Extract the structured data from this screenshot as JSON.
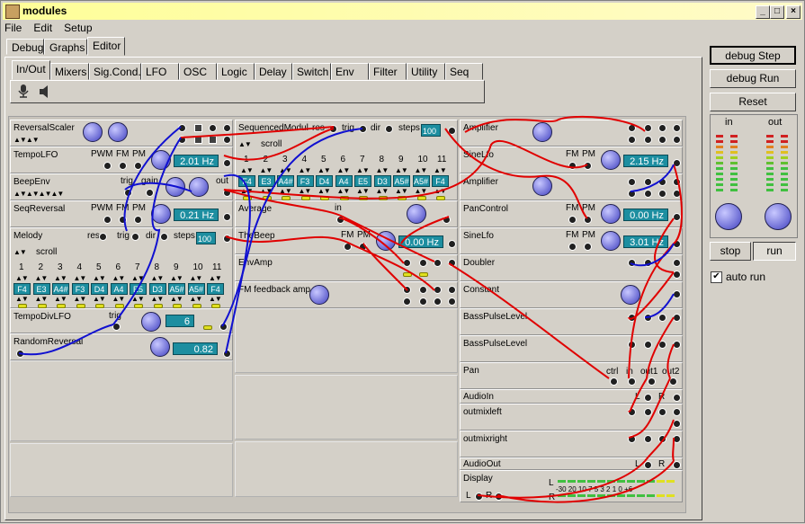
{
  "window": {
    "title": "modules",
    "buttons": [
      "_",
      "□",
      "×"
    ]
  },
  "menu": [
    "File",
    "Edit",
    "Setup"
  ],
  "main_tabs": [
    "Debug",
    "Graphs",
    "Editor"
  ],
  "sub_tabs": [
    "In/Out",
    "Mixers",
    "Sig.Cond.",
    "LFO",
    "OSC",
    "Logic",
    "Delay",
    "Switch",
    "Env",
    "Filter",
    "Utility",
    "Seq"
  ],
  "right_panel": {
    "debug_step": "debug Step",
    "debug_run": "debug Run",
    "reset": "Reset",
    "meter_in": "in",
    "meter_out": "out",
    "stop": "stop",
    "run": "run",
    "auto_run": "auto run"
  },
  "col1": {
    "reversal_scaler": "ReversalScaler",
    "tempo_lfo": "TempoLFO",
    "tempo_lfo_pwm": "PWM",
    "tempo_lfo_fm": "FM",
    "tempo_lfo_pm": "PM",
    "tempo_lfo_value": "2.01 Hz",
    "beep_env": "BeepEnv",
    "beep_env_trig": "trig",
    "beep_env_gain": "gain",
    "beep_env_out": "out",
    "seq_reversal": "SeqReversal",
    "seq_reversal_pwm": "PWM",
    "seq_reversal_fm": "FM",
    "seq_reversal_pm": "PM",
    "seq_reversal_value": "0.21 Hz",
    "melody": "Melody",
    "melody_res": "res",
    "melody_trig": "trig",
    "melody_dir": "dir",
    "melody_steps": "steps",
    "melody_steps_value": "100",
    "melody_scroll": "scroll",
    "melody_indices": [
      "1",
      "2",
      "3",
      "4",
      "5",
      "6",
      "7",
      "8",
      "9",
      "10",
      "11"
    ],
    "melody_notes": [
      "F4",
      "E3",
      "A4#",
      "F3",
      "D4",
      "A4",
      "E5",
      "D3",
      "A5#",
      "A5#",
      "F4"
    ],
    "tempo_div_lfo": "TempoDivLFO",
    "tempo_div_trig": "trig",
    "tempo_div_value": "6",
    "random_reversal": "RandomReversal",
    "random_reversal_value": "0.82"
  },
  "col2": {
    "sequenced_modul": "SequencedModul",
    "seq_res": "res",
    "seq_trig": "trig",
    "seq_dir": "dir",
    "seq_steps": "steps",
    "seq_steps_value": "100",
    "seq_scroll": "scroll",
    "seq_indices": [
      "1",
      "2",
      "3",
      "4",
      "5",
      "6",
      "7",
      "8",
      "9",
      "10",
      "11"
    ],
    "seq_notes": [
      "F4",
      "E3",
      "A4#",
      "F3",
      "D4",
      "A4",
      "E5",
      "D3",
      "A5#",
      "A5#",
      "F4"
    ],
    "average": "Average",
    "average_in": "in",
    "the_beep": "TheBeep",
    "the_beep_fm": "FM",
    "the_beep_pm": "PM",
    "the_beep_value": "0.00 Hz",
    "env_amp": "EnvAmp",
    "fm_feedback_amp": "FM feedback amp"
  },
  "col3": {
    "amplifier1": "Amplifier",
    "sine_lfo1": "SineLfo",
    "sine_lfo1_fm": "FM",
    "sine_lfo1_pm": "PM",
    "sine_lfo1_value": "2.15 Hz",
    "amplifier2": "Amplifier",
    "pan_control": "PanControl",
    "pan_control_fm": "FM",
    "pan_control_pm": "PM",
    "pan_control_value": "0.00 Hz",
    "sine_lfo2": "SineLfo",
    "sine_lfo2_fm": "FM",
    "sine_lfo2_pm": "PM",
    "sine_lfo2_value": "3.01 Hz",
    "doubler": "Doubler",
    "constant": "Constant",
    "bass_pulse_level1": "BassPulseLevel",
    "bass_pulse_level2": "BassPulseLevel",
    "pan": "Pan",
    "pan_ctrl": "ctrl",
    "pan_in": "in",
    "pan_out1": "out1",
    "pan_out2": "out2",
    "audio_in": "AudioIn",
    "audio_in_l": "L",
    "audio_in_r": "R",
    "outmix_left": "outmixleft",
    "outmix_right": "outmixright",
    "audio_out": "AudioOut",
    "audio_out_l": "L",
    "audio_out_r": "R",
    "display": "Display",
    "display_l": "L",
    "display_r": "R",
    "display_scale": "-30 20 10  7  5  3  2  1  0  +6"
  },
  "colors": {
    "wire_red": "#e00000",
    "wire_blue": "#1010d0",
    "display_bg": "#1d8ea0",
    "title_bg": "#fefe98"
  }
}
